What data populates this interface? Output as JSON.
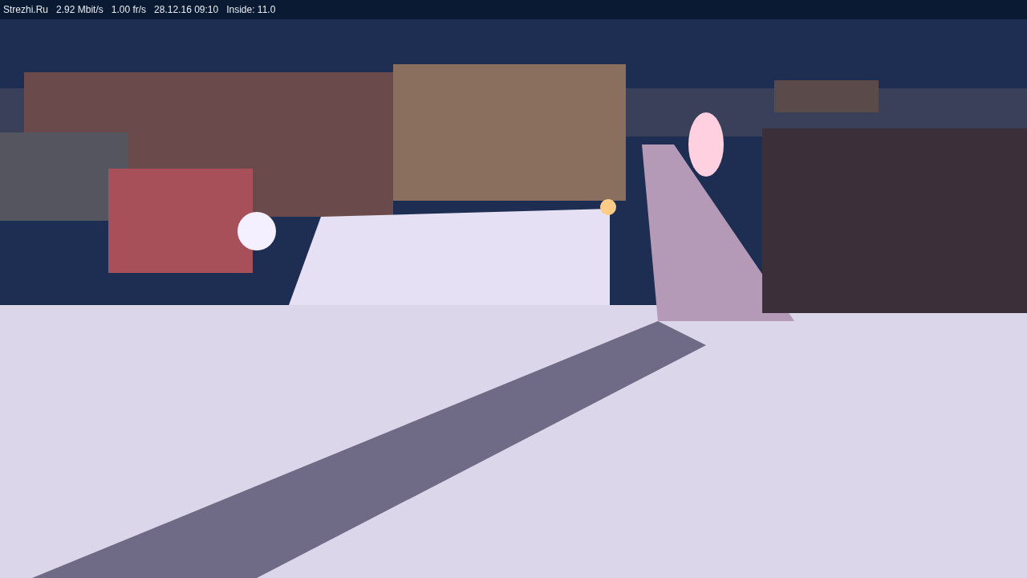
{
  "overlay": {
    "site": "Strezhi.Ru",
    "bitrate": "2.92 Mbit/s",
    "framerate": "1.00 fr/s",
    "datetime": "28.12.16 09:10",
    "sensor": "Inside: 11.0"
  }
}
